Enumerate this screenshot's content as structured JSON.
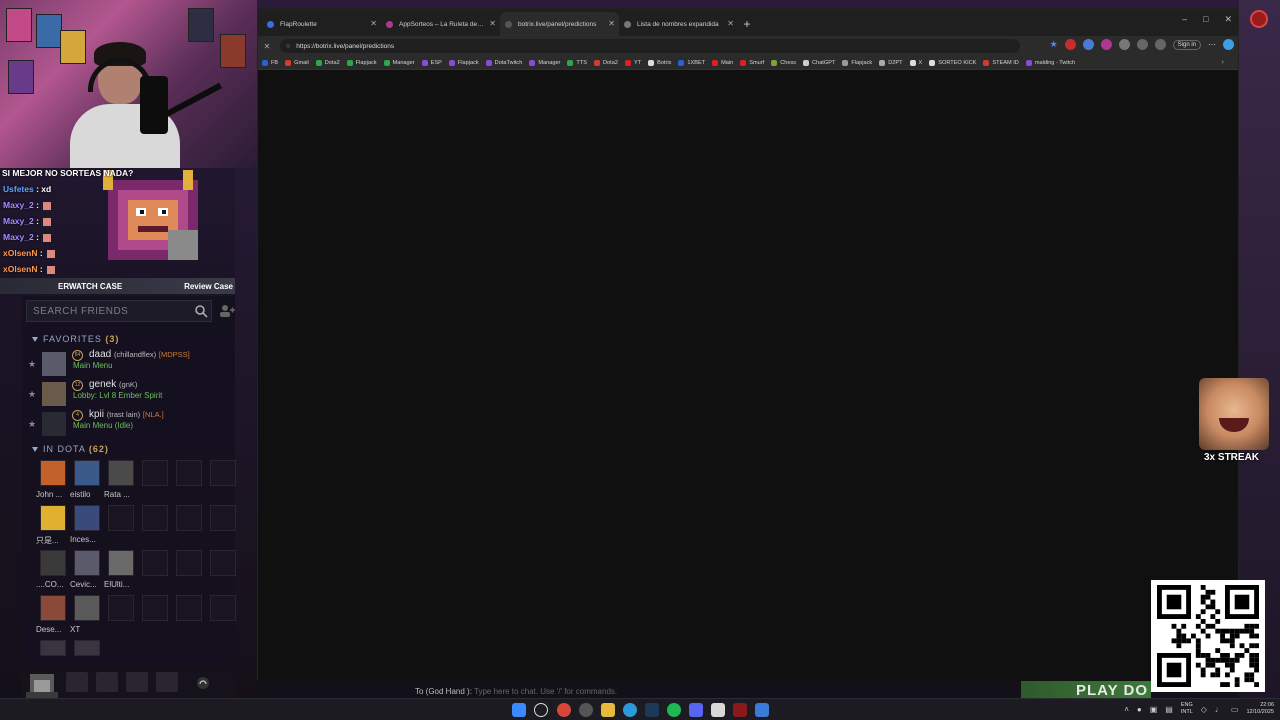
{
  "browser": {
    "tabs": [
      {
        "label": "FlapRoulette",
        "color": "#3b6de0",
        "active": false
      },
      {
        "label": "AppSorteos – La Ruleta de la Sue",
        "color": "#b0378f",
        "active": false
      },
      {
        "label": "botrix.live/panel/predictions",
        "color": "#555555",
        "active": true
      },
      {
        "label": "Lista de nombres expandida",
        "color": "#777777",
        "active": false
      }
    ],
    "new_tab": "+",
    "url": "https://botrix.live/panel/predictions",
    "sign_in": "Sign in",
    "bookmarks": [
      {
        "label": "FB",
        "color": "#2b5fd9"
      },
      {
        "label": "Gmail",
        "color": "#d33b2c"
      },
      {
        "label": "Dota2",
        "color": "#2aa84a"
      },
      {
        "label": "Flapjack",
        "color": "#2aa84a"
      },
      {
        "label": "Manager",
        "color": "#2aa84a"
      },
      {
        "label": "ESP",
        "color": "#8a4bd8"
      },
      {
        "label": "Flapjack",
        "color": "#8a4bd8"
      },
      {
        "label": "DotaTwitch",
        "color": "#8a4bd8"
      },
      {
        "label": "Manager",
        "color": "#8a4bd8"
      },
      {
        "label": "TTS",
        "color": "#2aa84a"
      },
      {
        "label": "Dota2",
        "color": "#d33b2c"
      },
      {
        "label": "YT",
        "color": "#e02020"
      },
      {
        "label": "Botrix",
        "color": "#dddddd"
      },
      {
        "label": "1XBET",
        "color": "#2b5fd9"
      },
      {
        "label": "Main",
        "color": "#e02020"
      },
      {
        "label": "Smurf",
        "color": "#e02020"
      },
      {
        "label": "Chess",
        "color": "#7ba33a"
      },
      {
        "label": "ChatGPT",
        "color": "#cccccc"
      },
      {
        "label": "Flapjack",
        "color": "#999999"
      },
      {
        "label": "D2PT",
        "color": "#aaaaaa"
      },
      {
        "label": "X",
        "color": "#dddddd"
      },
      {
        "label": "SORTEO KICK",
        "color": "#dddddd"
      },
      {
        "label": "STEAM ID",
        "color": "#d33b2c"
      },
      {
        "label": "malding - Twitch",
        "color": "#8a4bd8"
      }
    ]
  },
  "chat": {
    "header": "SI MEJOR NO SORTEAS NADA?",
    "lines": [
      {
        "user": "Usfetes",
        "msg": "xd",
        "color": "#5fa8ff"
      },
      {
        "user": "Maxy_2",
        "msg": "",
        "color": "#a58cff"
      },
      {
        "user": "Maxy_2",
        "msg": "",
        "color": "#a58cff"
      },
      {
        "user": "Maxy_2",
        "msg": "",
        "color": "#a58cff"
      },
      {
        "user": "xOlsenN",
        "msg": "",
        "color": "#ff9a4a"
      },
      {
        "user": "xOlsenN",
        "msg": "",
        "color": "#ff9a4a"
      },
      {
        "user": "xOlsenN",
        "msg": "",
        "color": "#ff9a4a"
      }
    ],
    "overwatch_label": "ERWATCH CASE",
    "review_case": "Review Case"
  },
  "friends": {
    "search_placeholder": "SEARCH FRIENDS",
    "favorites_label": "FAVORITES",
    "favorites_count": "(3)",
    "favorites": [
      {
        "level": "84",
        "name": "daad",
        "alias": "(chillandflex)",
        "tag": "[MDPSS]",
        "status": "Main Menu"
      },
      {
        "level": "12",
        "name": "genek",
        "alias": "(gnK)",
        "tag": "",
        "status": "Lobby: Lvl 8 Ember Spirit"
      },
      {
        "level": "4",
        "name": "kpii",
        "alias": "(trast lain)",
        "tag": "[NLA.]",
        "status": "Main Menu (Idle)"
      }
    ],
    "in_dota_label": "IN DOTA",
    "in_dota_count": "(62)",
    "grid_names": [
      [
        "John ...",
        "eistilo",
        "Rata ..."
      ],
      [
        "只是...",
        "Inces..."
      ],
      [
        "....CO...",
        "Cevic...",
        "ElUlti..."
      ],
      [
        "Dese...",
        "XT"
      ]
    ]
  },
  "game": {
    "chat_prefix": "To (God Hand ):",
    "chat_placeholder": "Type here to chat. Use '/' for commands.",
    "play_button": "PLAY DO"
  },
  "overlay": {
    "streak": "3x STREAK"
  },
  "taskbar": {
    "lang_top": "ENG",
    "lang_bottom": "INTL",
    "time": "22:06",
    "date": "12/10/2025"
  }
}
